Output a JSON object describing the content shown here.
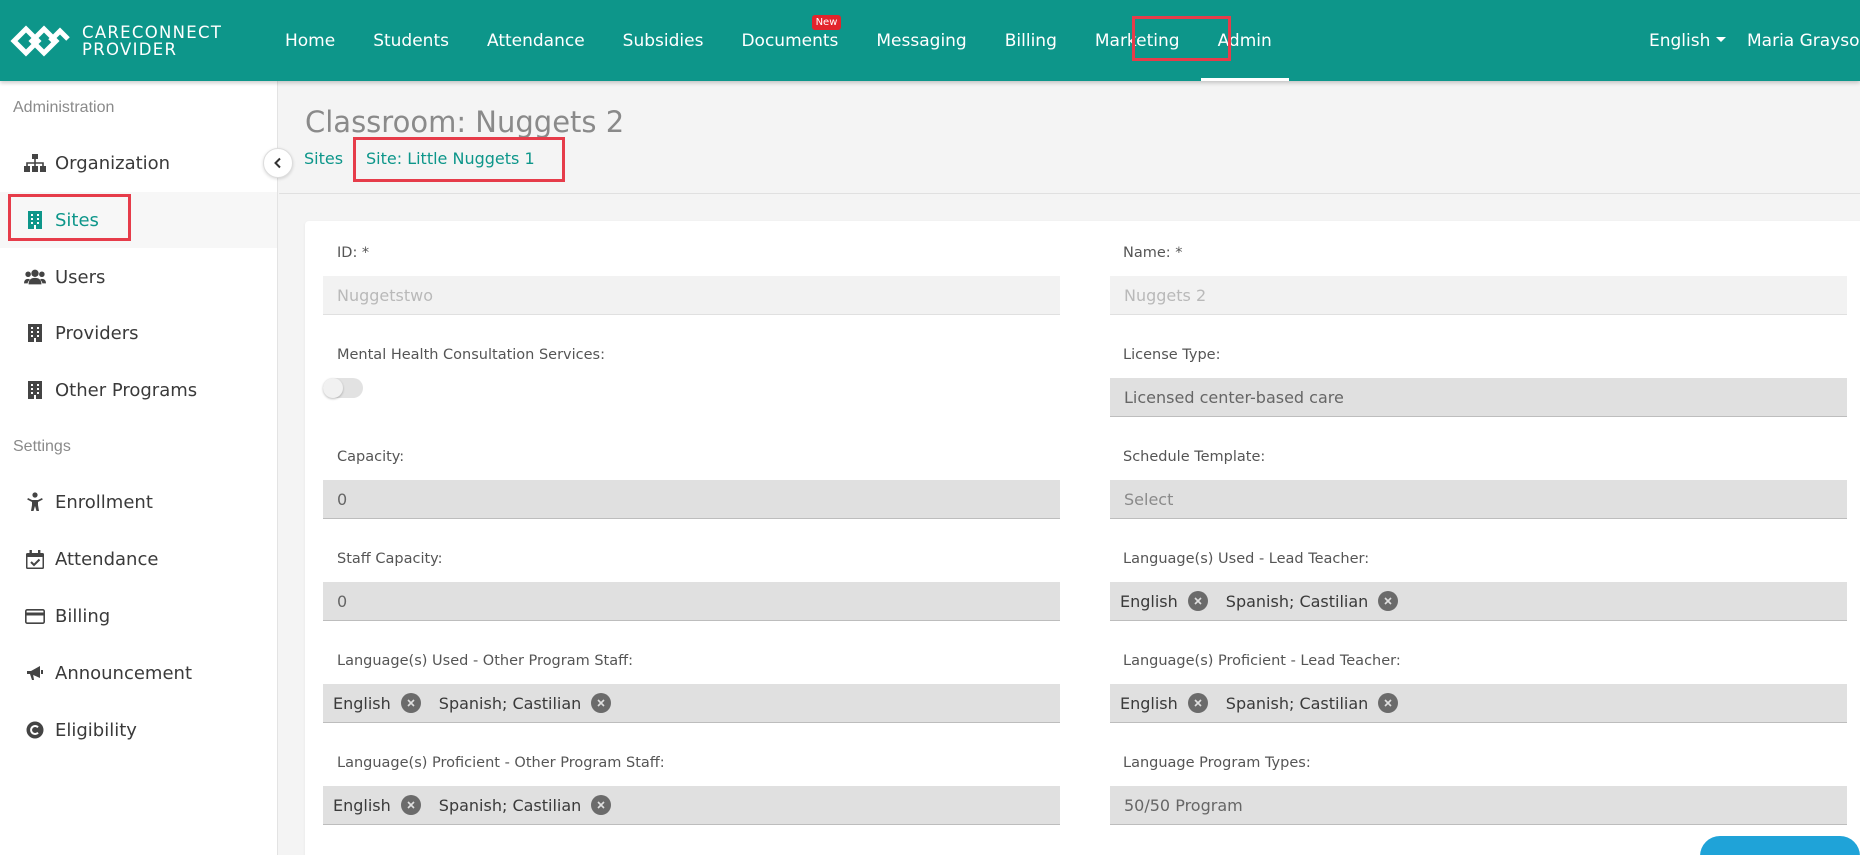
{
  "brand": {
    "line1": "CARECONNECT",
    "line2": "PROVIDER"
  },
  "nav": {
    "items": [
      {
        "label": "Home",
        "name": "nav-home"
      },
      {
        "label": "Students",
        "name": "nav-students"
      },
      {
        "label": "Attendance",
        "name": "nav-attendance"
      },
      {
        "label": "Subsidies",
        "name": "nav-subsidies"
      },
      {
        "label": "Documents",
        "name": "nav-documents",
        "badge": "New"
      },
      {
        "label": "Messaging",
        "name": "nav-messaging"
      },
      {
        "label": "Billing",
        "name": "nav-billing"
      },
      {
        "label": "Marketing",
        "name": "nav-marketing"
      },
      {
        "label": "Admin",
        "name": "nav-admin",
        "active": true
      }
    ],
    "language": "English",
    "user": "Maria Grayson"
  },
  "sidebar": {
    "section_admin": "Administration",
    "section_settings": "Settings",
    "items": [
      {
        "label": "Organization",
        "icon": "sitemap-icon"
      },
      {
        "label": "Sites",
        "icon": "building-icon",
        "active": true
      },
      {
        "label": "Users",
        "icon": "users-icon"
      },
      {
        "label": "Providers",
        "icon": "building-icon"
      },
      {
        "label": "Other Programs",
        "icon": "building-icon"
      },
      {
        "label": "Enrollment",
        "icon": "child-icon"
      },
      {
        "label": "Attendance",
        "icon": "calendar-check-icon"
      },
      {
        "label": "Billing",
        "icon": "credit-card-icon"
      },
      {
        "label": "Announcement",
        "icon": "bullhorn-icon"
      },
      {
        "label": "Eligibility",
        "icon": "copyright-icon"
      }
    ]
  },
  "page": {
    "title": "Classroom: Nuggets 2",
    "breadcrumbs": [
      "Sites",
      "Site: Little Nuggets 1"
    ]
  },
  "form": {
    "id_label": "ID: *",
    "id_value": "Nuggetstwo",
    "name_label": "Name: *",
    "name_value": "Nuggets 2",
    "mental_label": "Mental Health Consultation Services:",
    "mental_on": false,
    "license_label": "License Type:",
    "license_value": "Licensed center-based care",
    "capacity_label": "Capacity:",
    "capacity_value": "0",
    "schedule_label": "Schedule Template:",
    "schedule_placeholder": "Select",
    "staff_capacity_label": "Staff Capacity:",
    "staff_capacity_value": "0",
    "lang_used_lead_label": "Language(s) Used - Lead Teacher:",
    "lang_used_lead": [
      "English",
      "Spanish; Castilian"
    ],
    "lang_used_other_label": "Language(s) Used - Other Program Staff:",
    "lang_used_other": [
      "English",
      "Spanish; Castilian"
    ],
    "lang_prof_lead_label": "Language(s) Proficient - Lead Teacher:",
    "lang_prof_lead": [
      "English",
      "Spanish; Castilian"
    ],
    "lang_prof_other_label": "Language(s) Proficient - Other Program Staff:",
    "lang_prof_other": [
      "English",
      "Spanish; Castilian"
    ],
    "program_types_label": "Language Program Types:",
    "program_types_value": "50/50 Program"
  },
  "colors": {
    "brand": "#0d968a",
    "highlight": "#e63c4a",
    "badge": "#e3242b"
  }
}
